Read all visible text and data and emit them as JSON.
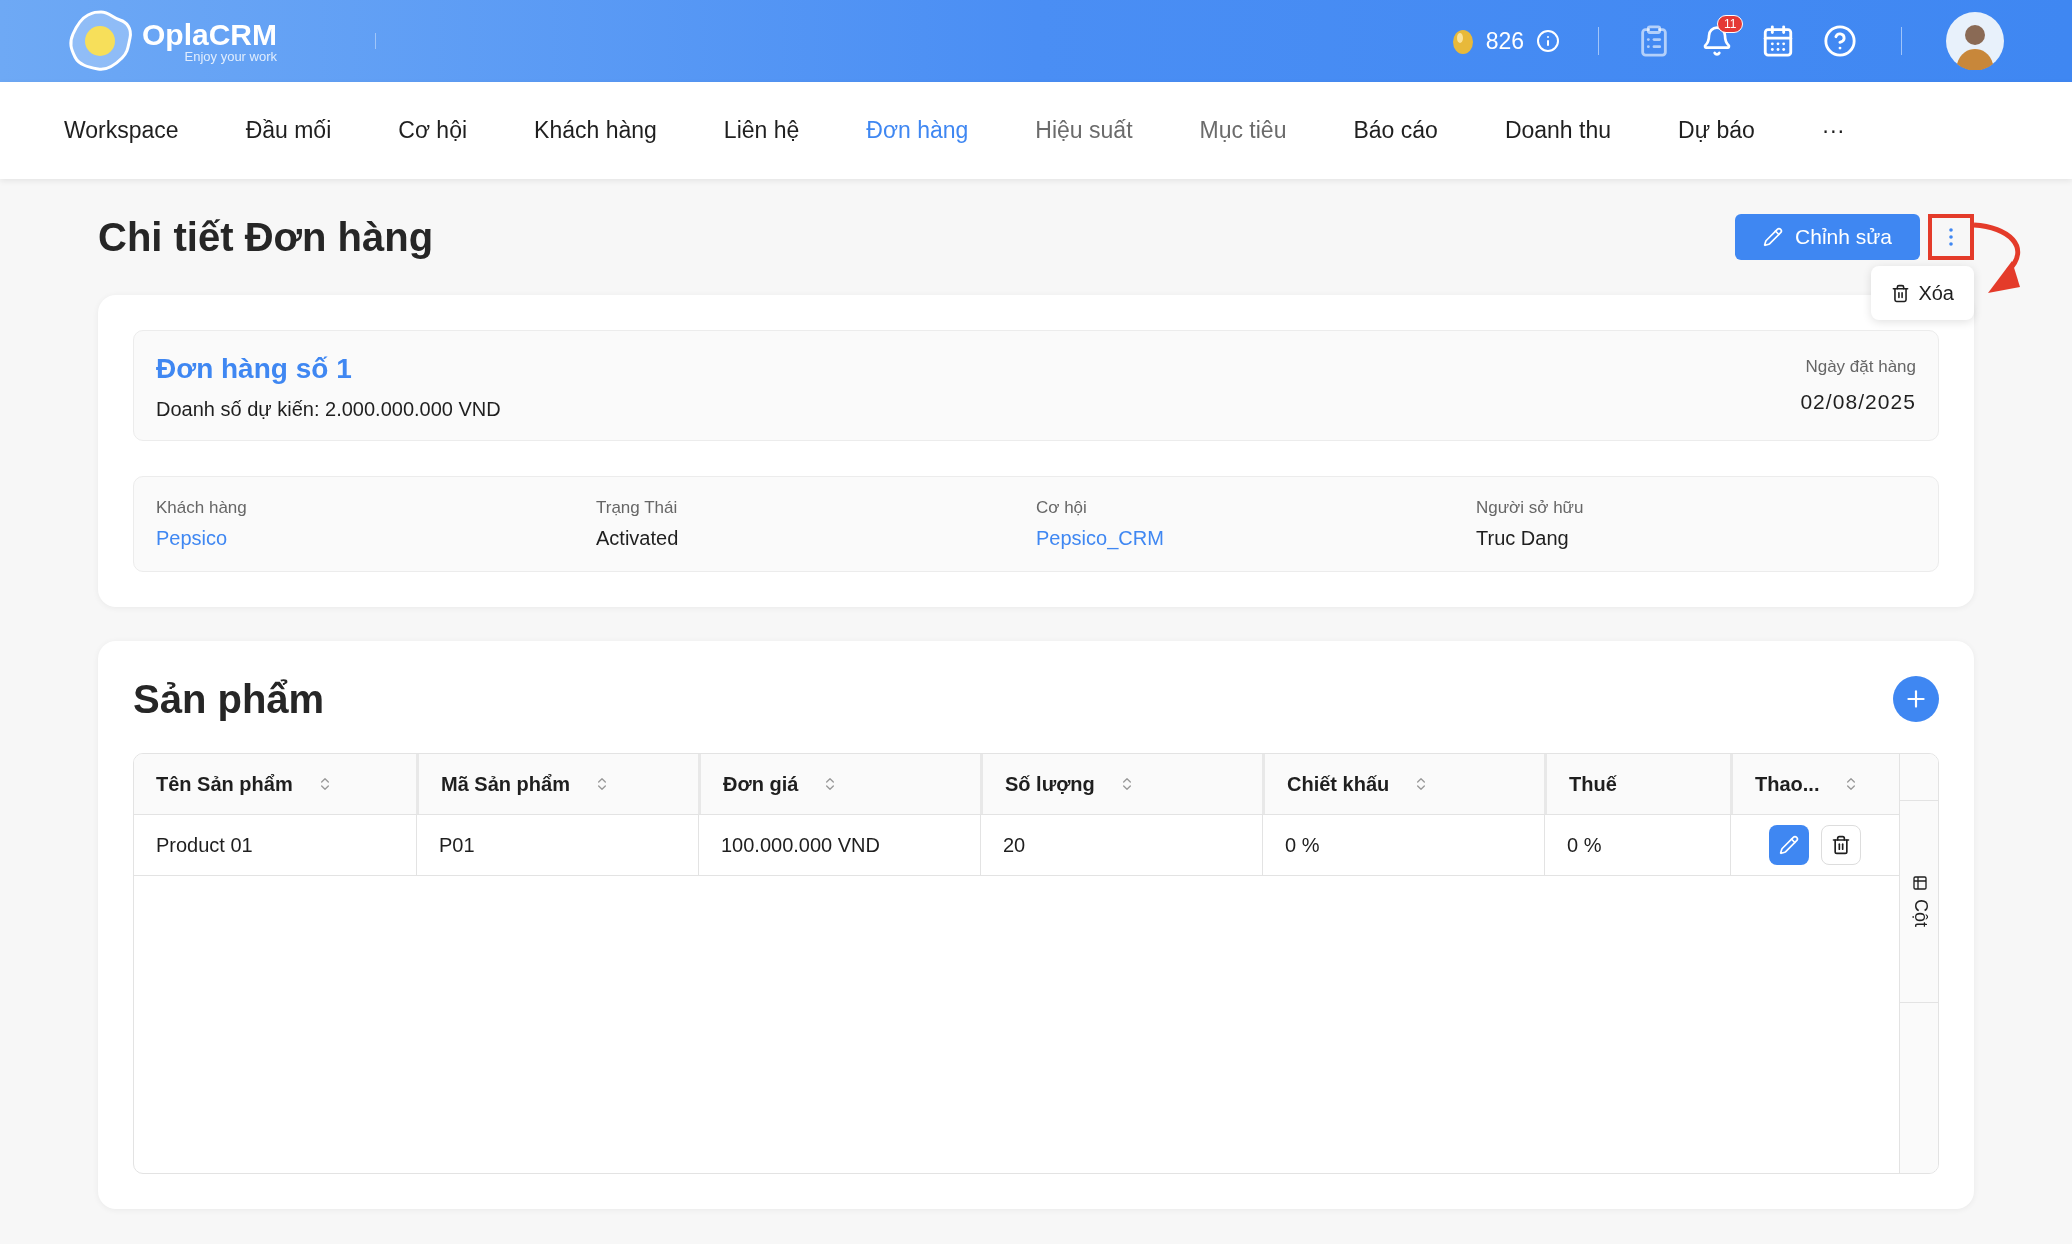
{
  "header": {
    "logo_name": "OplaCRM",
    "logo_tagline": "Enjoy your work",
    "coins": "826",
    "notification_count": "11"
  },
  "nav": [
    {
      "label": "Workspace",
      "selected": false,
      "disabled": false
    },
    {
      "label": "Đầu mối",
      "selected": false,
      "disabled": false
    },
    {
      "label": "Cơ hội",
      "selected": false,
      "disabled": false
    },
    {
      "label": "Khách hàng",
      "selected": false,
      "disabled": false
    },
    {
      "label": "Liên hệ",
      "selected": false,
      "disabled": false
    },
    {
      "label": "Đơn hàng",
      "selected": true,
      "disabled": false
    },
    {
      "label": "Hiệu suất",
      "selected": false,
      "disabled": true
    },
    {
      "label": "Mục tiêu",
      "selected": false,
      "disabled": true
    },
    {
      "label": "Báo cáo",
      "selected": false,
      "disabled": false
    },
    {
      "label": "Doanh thu",
      "selected": false,
      "disabled": false
    },
    {
      "label": "Dự báo",
      "selected": false,
      "disabled": false
    },
    {
      "label": "···",
      "selected": false,
      "disabled": false
    }
  ],
  "page": {
    "title": "Chi tiết Đơn hàng",
    "edit_button": "Chỉnh sửa",
    "menu": {
      "open": true,
      "items": [
        "Xóa"
      ]
    }
  },
  "order": {
    "title": "Đơn hàng số 1",
    "expected_sales": "Doanh số dự kiến: 2.000.000.000 VND",
    "date_label": "Ngày đặt hàng",
    "date": "02/08/2025"
  },
  "fields": [
    {
      "label": "Khách hàng",
      "value": "Pepsico",
      "kind": "link"
    },
    {
      "label": "Trạng Thái",
      "value": "Activated",
      "kind": "text"
    },
    {
      "label": "Cơ hội",
      "value": "Pepsico_CRM",
      "kind": "link"
    },
    {
      "label": "Người sở hữu",
      "value": "Truc Dang",
      "kind": "text"
    }
  ],
  "products": {
    "title": "Sản phẩm",
    "column_panel": "Cột",
    "columns": [
      {
        "label": "Tên Sản phẩm",
        "sortable": true
      },
      {
        "label": "Mã Sản phẩm",
        "sortable": true
      },
      {
        "label": "Đơn giá",
        "sortable": true
      },
      {
        "label": "Số lượng",
        "sortable": true
      },
      {
        "label": "Chiết khấu",
        "sortable": true
      },
      {
        "label": "Thuế",
        "sortable": false
      },
      {
        "label": "Thao...",
        "sortable": true
      }
    ],
    "rows": [
      {
        "cells": [
          "Product 01",
          "P01",
          "100.000.000 VND",
          "20",
          "0 %",
          "0 %"
        ]
      }
    ]
  }
}
